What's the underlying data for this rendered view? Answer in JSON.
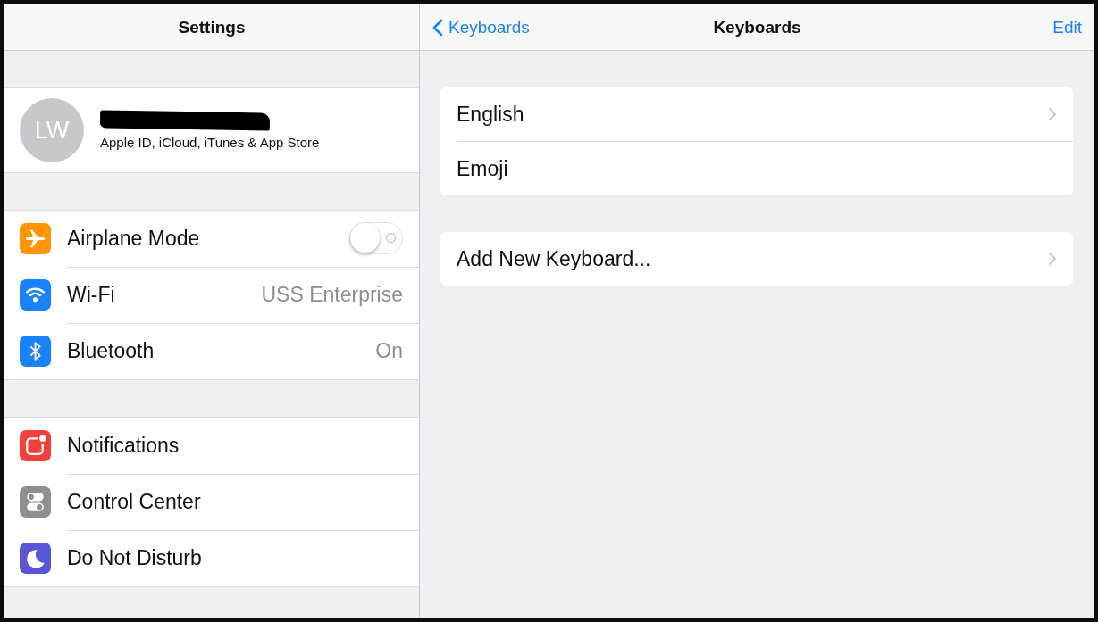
{
  "master": {
    "title": "Settings",
    "profile": {
      "initials": "LW",
      "subtitle": "Apple ID, iCloud, iTunes & App Store"
    },
    "groups": [
      [
        {
          "label": "Airplane Mode",
          "kind": "toggle",
          "on": false,
          "color": "#ff9500"
        },
        {
          "label": "Wi-Fi",
          "kind": "value",
          "value": "USS Enterprise",
          "color": "#1a82fb"
        },
        {
          "label": "Bluetooth",
          "kind": "value",
          "value": "On",
          "color": "#1a82fb"
        }
      ],
      [
        {
          "label": "Notifications",
          "kind": "plain",
          "color": "#f2403a"
        },
        {
          "label": "Control Center",
          "kind": "plain",
          "color": "#8e8e93"
        },
        {
          "label": "Do Not Disturb",
          "kind": "plain",
          "color": "#5856d6"
        }
      ]
    ]
  },
  "detail": {
    "back": "Keyboards",
    "title": "Keyboards",
    "action": "Edit",
    "groups": [
      [
        {
          "label": "English",
          "chevron": true
        },
        {
          "label": "Emoji",
          "chevron": false
        }
      ],
      [
        {
          "label": "Add New Keyboard...",
          "chevron": true
        }
      ]
    ]
  }
}
